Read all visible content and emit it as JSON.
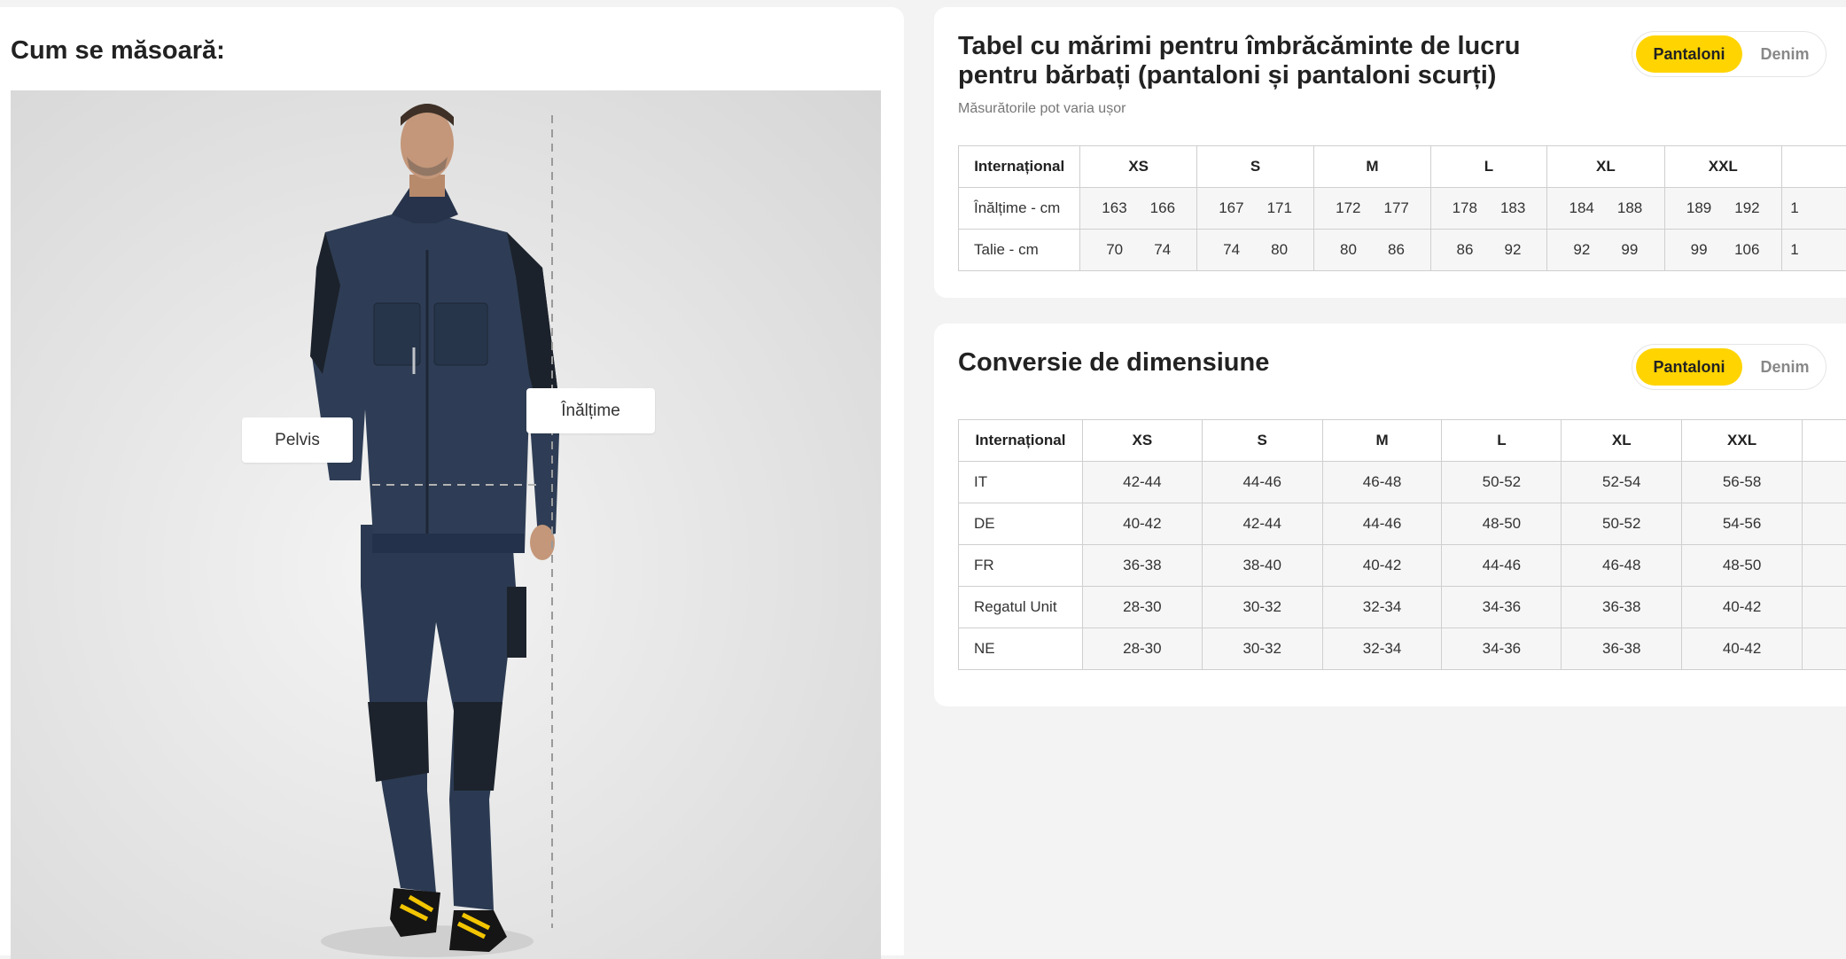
{
  "measure": {
    "title": "Cum se măsoară:",
    "pelvis_label": "Pelvis",
    "height_label": "Înălțime"
  },
  "size_chart": {
    "title": "Tabel cu mărimi pentru îmbrăcăminte de lucru pentru bărbați (pantaloni și pantaloni scurți)",
    "subtitle": "Măsurătorile pot varia ușor",
    "toggle": {
      "active": "Pantaloni",
      "inactive": "Denim"
    },
    "columns": [
      "Internațional",
      "XS",
      "S",
      "M",
      "L",
      "XL",
      "XXL",
      ""
    ],
    "rows": [
      {
        "label": "Înălțime - cm",
        "values": [
          [
            "163",
            "166"
          ],
          [
            "167",
            "171"
          ],
          [
            "172",
            "177"
          ],
          [
            "178",
            "183"
          ],
          [
            "184",
            "188"
          ],
          [
            "189",
            "192"
          ],
          [
            "1",
            ""
          ]
        ]
      },
      {
        "label": "Talie - cm",
        "values": [
          [
            "70",
            "74"
          ],
          [
            "74",
            "80"
          ],
          [
            "80",
            "86"
          ],
          [
            "86",
            "92"
          ],
          [
            "92",
            "99"
          ],
          [
            "99",
            "106"
          ],
          [
            "1",
            ""
          ]
        ]
      }
    ]
  },
  "conversion": {
    "title": "Conversie de dimensiune",
    "toggle": {
      "active": "Pantaloni",
      "inactive": "Denim"
    },
    "columns": [
      "Internațional",
      "XS",
      "S",
      "M",
      "L",
      "XL",
      "XXL",
      ""
    ],
    "rows": [
      {
        "label": "IT",
        "values": [
          "42-44",
          "44-46",
          "46-48",
          "50-52",
          "52-54",
          "56-58",
          ""
        ]
      },
      {
        "label": "DE",
        "values": [
          "40-42",
          "42-44",
          "44-46",
          "48-50",
          "50-52",
          "54-56",
          ""
        ]
      },
      {
        "label": "FR",
        "values": [
          "36-38",
          "38-40",
          "40-42",
          "44-46",
          "46-48",
          "48-50",
          ""
        ]
      },
      {
        "label": "Regatul Unit",
        "values": [
          "28-30",
          "30-32",
          "32-34",
          "34-36",
          "36-38",
          "40-42",
          ""
        ]
      },
      {
        "label": "NE",
        "values": [
          "28-30",
          "30-32",
          "32-34",
          "34-36",
          "36-38",
          "40-42",
          ""
        ]
      }
    ]
  },
  "colors": {
    "accent": "#ffd400",
    "workwear": "#2b3a52"
  }
}
